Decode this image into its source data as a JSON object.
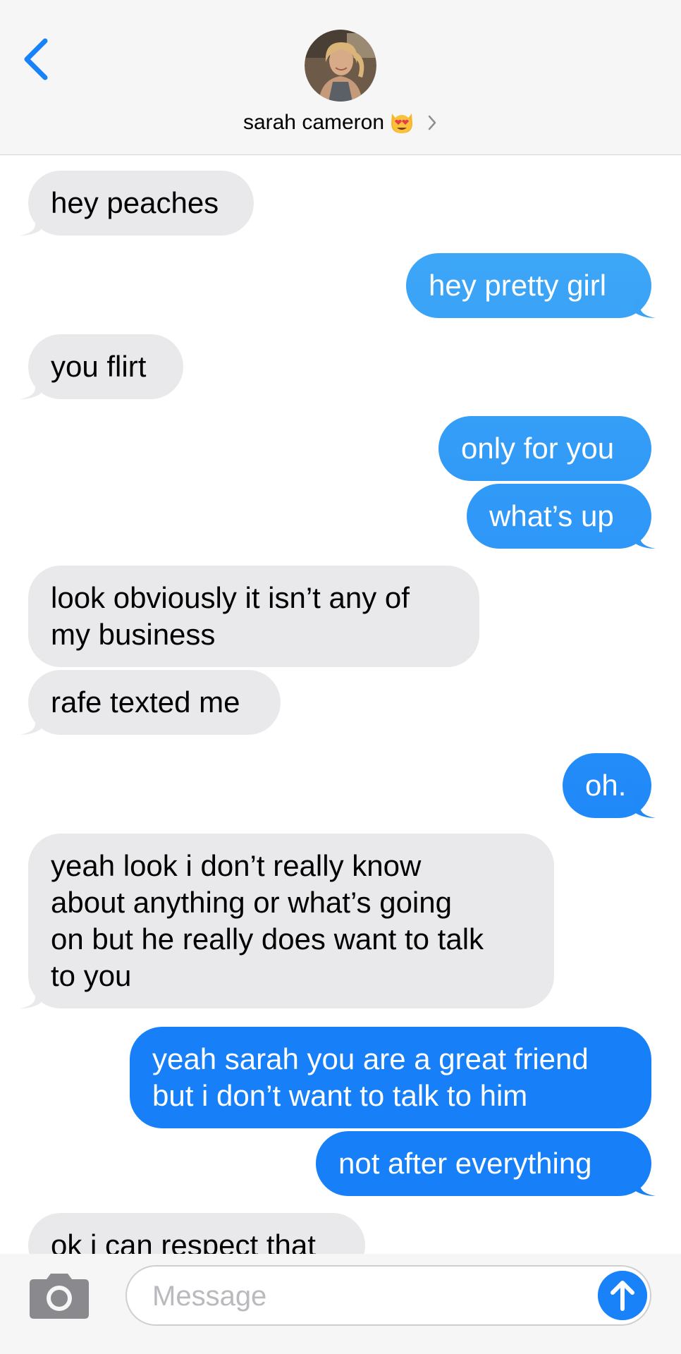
{
  "header": {
    "contact_name": "sarah cameron",
    "contact_emoji": "heart-eyes-cat-icon",
    "back_icon": "chevron-left-icon",
    "details_icon": "chevron-right-icon"
  },
  "colors": {
    "accent": "#1a82f8",
    "incoming_bubble": "#e9e9eb",
    "outgoing_gradient_top": "#4ab3f6",
    "outgoing_gradient_bottom": "#1780f9"
  },
  "messages": [
    {
      "direction": "in",
      "text": "hey peaches"
    },
    {
      "direction": "out",
      "text": "hey pretty girl"
    },
    {
      "direction": "in",
      "text": "you flirt"
    },
    {
      "direction": "out",
      "text": "only for you"
    },
    {
      "direction": "out",
      "text": "what’s up"
    },
    {
      "direction": "in",
      "lines": [
        "look obviously it isn’t any of",
        "my business"
      ]
    },
    {
      "direction": "in",
      "text": "rafe texted me"
    },
    {
      "direction": "out",
      "text": "oh."
    },
    {
      "direction": "in",
      "lines": [
        "yeah look i don’t really know",
        "about anything or what’s going",
        "on but he really does want to talk",
        "to you"
      ]
    },
    {
      "direction": "out",
      "lines": [
        "yeah sarah you are a great friend",
        "but i don’t want to talk to him"
      ]
    },
    {
      "direction": "out",
      "text": "not after everything"
    },
    {
      "direction": "in",
      "text": "ok i can respect that"
    }
  ],
  "composer": {
    "placeholder": "Message",
    "camera_icon": "camera-icon",
    "send_icon": "arrow-up-icon"
  }
}
